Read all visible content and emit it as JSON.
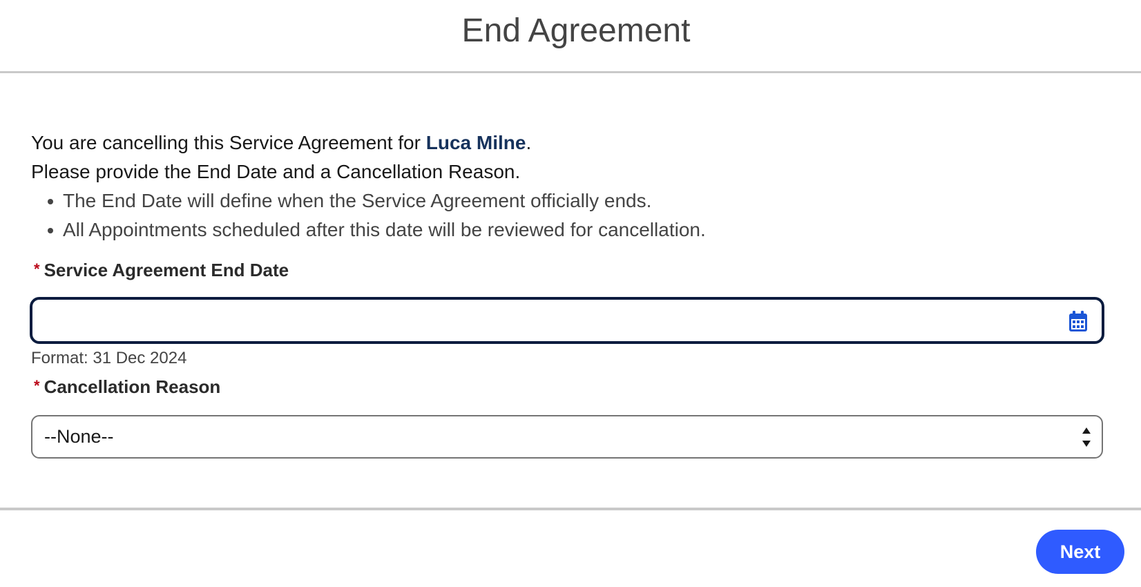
{
  "header": {
    "title": "End Agreement"
  },
  "intro": {
    "line1_prefix": "You are cancelling this Service Agreement for ",
    "account_name": "Luca Milne",
    "line1_suffix": ".",
    "line2": "Please provide the End Date and a Cancellation Reason.",
    "bullets": [
      "The End Date will define when the Service Agreement officially ends.",
      "All Appointments scheduled after this date will be reviewed for cancellation."
    ]
  },
  "end_date_field": {
    "required_marker": "*",
    "label": "Service Agreement End Date",
    "value": "",
    "format_hint": "Format: 31 Dec 2024",
    "icon": "calendar-icon"
  },
  "cancellation_reason_field": {
    "required_marker": "*",
    "label": "Cancellation Reason",
    "selected_value": "--None--"
  },
  "footer": {
    "next_label": "Next"
  },
  "colors": {
    "primary_button": "#2f5bff",
    "focus_border": "#0b1c3f",
    "required_marker": "#ba0517",
    "calendar_icon": "#1b56d6",
    "account_name": "#16325c"
  }
}
